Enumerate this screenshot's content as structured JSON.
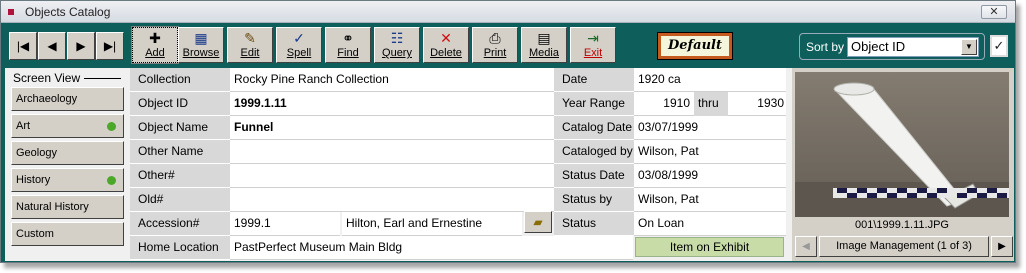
{
  "window": {
    "title": "Objects Catalog",
    "close_glyph": "✕"
  },
  "nav": {
    "first": "|◀",
    "prev": "◀",
    "next": "▶",
    "last": "▶|"
  },
  "toolbar": [
    {
      "key": "add",
      "label": "Add",
      "icon": "plus-icon",
      "glyph": "✚"
    },
    {
      "key": "browse",
      "label": "Browse",
      "icon": "grid-icon",
      "glyph": "▦"
    },
    {
      "key": "edit",
      "label": "Edit",
      "icon": "edit-icon",
      "glyph": "✎"
    },
    {
      "key": "spell",
      "label": "Spell",
      "icon": "spellcheck-icon",
      "glyph": "✓"
    },
    {
      "key": "find",
      "label": "Find",
      "icon": "binoculars-icon",
      "glyph": "⚭"
    },
    {
      "key": "query",
      "label": "Query",
      "icon": "query-icon",
      "glyph": "☷"
    },
    {
      "key": "delete",
      "label": "Delete",
      "icon": "delete-x-icon",
      "glyph": "✕"
    },
    {
      "key": "print",
      "label": "Print",
      "icon": "printer-icon",
      "glyph": "⎙"
    },
    {
      "key": "media",
      "label": "Media",
      "icon": "filmstrip-icon",
      "glyph": "▤"
    },
    {
      "key": "exit",
      "label": "Exit",
      "icon": "exit-door-icon",
      "glyph": "⇥"
    }
  ],
  "default_badge": "Default",
  "sort": {
    "label": "Sort by",
    "value": "Object ID"
  },
  "screen_view": {
    "title": "Screen View",
    "items": [
      {
        "label": "Archaeology",
        "dot": false
      },
      {
        "label": "Art",
        "dot": true
      },
      {
        "label": "Geology",
        "dot": false
      },
      {
        "label": "History",
        "dot": true
      },
      {
        "label": "Natural History",
        "dot": false
      },
      {
        "label": "Custom",
        "dot": false
      }
    ],
    "dot_color": "#4ca82a"
  },
  "fields": {
    "collection": {
      "label": "Collection",
      "value": "Rocky Pine Ranch Collection"
    },
    "object_id": {
      "label": "Object ID",
      "value": "1999.1.11"
    },
    "object_name": {
      "label": "Object Name",
      "value": "Funnel"
    },
    "other_name": {
      "label": "Other Name",
      "value": ""
    },
    "other_num": {
      "label": "Other#",
      "value": ""
    },
    "old_num": {
      "label": "Old#",
      "value": ""
    },
    "accession": {
      "label": "Accession#",
      "value": "1999.1",
      "donor": "Hilton, Earl and Ernestine"
    },
    "home_location": {
      "label": "Home Location",
      "value": "PastPerfect Museum Main Bldg"
    },
    "date": {
      "label": "Date",
      "value": "1920 ca"
    },
    "year_range": {
      "label": "Year Range",
      "from": "1910",
      "thru": "thru",
      "to": "1930"
    },
    "catalog_date": {
      "label": "Catalog Date",
      "value": "03/07/1999"
    },
    "cataloged_by": {
      "label": "Cataloged by",
      "value": "Wilson, Pat"
    },
    "status_date": {
      "label": "Status Date",
      "value": "03/08/1999"
    },
    "status_by": {
      "label": "Status by",
      "value": "Wilson, Pat"
    },
    "status": {
      "label": "Status",
      "value": "On Loan"
    }
  },
  "exhibit": "Item on Exhibit",
  "image": {
    "caption": "001\\1999.1.11.JPG",
    "management": "Image Management (1 of 3)"
  },
  "colors": {
    "window_bg": "#0e5e5b",
    "exit_red": "#c00000",
    "badge_border": "#c55a1e",
    "exhibit_green": "#c8dca8"
  }
}
